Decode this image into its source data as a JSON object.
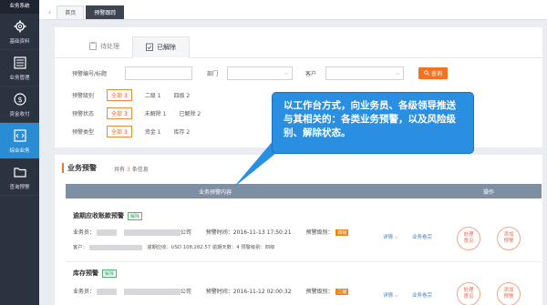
{
  "sidebar": {
    "header": "业务系统",
    "items": [
      {
        "label": "基础资料",
        "icon": "gear-icon"
      },
      {
        "label": "业务管理",
        "icon": "list-icon"
      },
      {
        "label": "资金收付",
        "icon": "dollar-icon"
      },
      {
        "label": "综合业务",
        "icon": "code-icon"
      },
      {
        "label": "查询预警",
        "icon": "folder-icon"
      }
    ]
  },
  "tabs": {
    "home": "首页",
    "current": "预警跟踪"
  },
  "subtabs": {
    "pending": "待处理",
    "resolved": "已解除"
  },
  "filters": {
    "code_label": "预警编号/标题",
    "dept_label": "部门",
    "customer_label": "客户",
    "search_button": "查询",
    "level_label": "预警级别",
    "level_selected": "全部",
    "level_selected_count": "3",
    "level_opt1": "二级 1",
    "level_opt2": "四级 2",
    "status_label": "预警状态",
    "status_selected": "全部",
    "status_selected_count": "3",
    "status_opt1": "未解除 1",
    "status_opt2": "已解除 2",
    "type_label": "预警类型",
    "type_selected": "全部",
    "type_selected_count": "3",
    "type_opt1": "资金 1",
    "type_opt2": "库存 2"
  },
  "list": {
    "title": "业务预警",
    "count_prefix": "共有",
    "count": "3",
    "count_suffix": "条信息",
    "col_content": "业务预警内容",
    "col_action": "操作"
  },
  "cards": [
    {
      "title": "逾期应收账款预警",
      "tag": "解除",
      "salesman_prefix": "业务员：",
      "company_suffix": "公司",
      "time": "预警时间：2016-11-13  17:50:21",
      "level_prefix": "预警级别：",
      "level": "四级",
      "customer_prefix": "客户：",
      "detail": "逾期应收：USD 108,282.57    逾期天数：4    预警级别：四级",
      "detail_link": "详情",
      "ref_link": "业务卷宗",
      "btn1": "处理\n意见",
      "btn2": "添加\n预警"
    },
    {
      "title": "库存预警",
      "tag": "解除",
      "salesman_prefix": "业务员：",
      "company_suffix": "公司",
      "time": "预警时间：2016-11-12  02:00:32",
      "level_prefix": "预警级别：",
      "level": "二级",
      "detail_link": "详情",
      "ref_link": "业务卷宗",
      "btn1": "处理\n意见",
      "btn2": "添加\n预警"
    }
  ],
  "callout": "以工作台方式，向业务员、各级领导推送与其相关的：各类业务预警，以及风险级别、解除状态。",
  "colors": {
    "accent": "#f5731f",
    "sidebar": "#2b3240",
    "active": "#2a8dd4",
    "callout": "#2a8fe0"
  }
}
